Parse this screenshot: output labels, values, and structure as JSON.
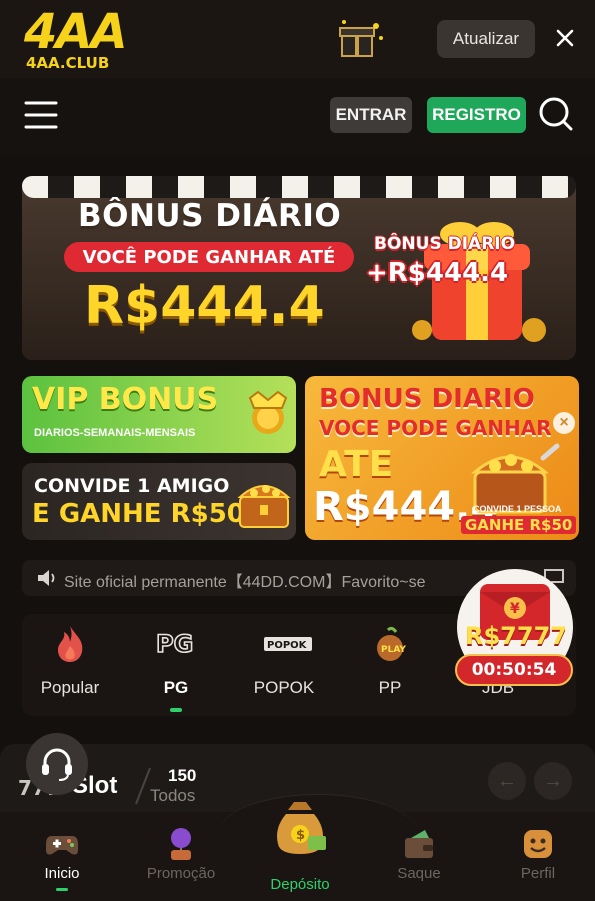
{
  "header": {
    "logo_main": "4AA",
    "logo_sub": "4AA.CLUB",
    "update_label": "Atualizar"
  },
  "nav": {
    "login_label": "ENTRAR",
    "register_label": "REGISTRO"
  },
  "hero": {
    "title": "BÔNUS DIÁRIO",
    "pill": "VOCÊ PODE GANHAR ATÉ",
    "amount": "R$444.4",
    "badge_line1": "BÔNUS DIÁRIO",
    "badge_line2": "+R$444.4"
  },
  "cards": {
    "vip_title": "VIP BONUS",
    "vip_sub": "DIARIOS-SEMANAIS-MENSAIS",
    "convide_line1": "CONVIDE 1 AMIGO",
    "convide_line2": "E GANHE R$50",
    "bonus_line1": "BONUS DIARIO",
    "bonus_line2": "VOCE PODE GANHAR",
    "bonus_line3": "ATE",
    "bonus_line4": "R$444.4",
    "bonus_tag1": "CONVIDE 1 PESSOA",
    "bonus_tag2": "GANHE R$50"
  },
  "marquee": {
    "text": "Site oficial permanente【44DD.COM】Favorito~se"
  },
  "categories": [
    {
      "label": "Popular",
      "icon": "fire-icon"
    },
    {
      "label": "PG",
      "icon": "pg-logo-icon"
    },
    {
      "label": "POPOK",
      "icon": "popok-logo-icon"
    },
    {
      "label": "PP",
      "icon": "pp-play-icon"
    },
    {
      "label": "JDB",
      "icon": "jdb-logo-icon"
    }
  ],
  "promo_float": {
    "amount": "R$7777",
    "timer": "00:50:54"
  },
  "section": {
    "icon_text": "777",
    "title": "Slot",
    "count": "150",
    "all_label": "Todos"
  },
  "tabs": [
    {
      "label": "Inicio",
      "icon": "gamepad-icon"
    },
    {
      "label": "Promoção",
      "icon": "promo-balloon-icon"
    },
    {
      "label": "Depósito",
      "icon": "money-bag-icon"
    },
    {
      "label": "Saque",
      "icon": "wallet-icon"
    },
    {
      "label": "Perfil",
      "icon": "smiley-profile-icon"
    }
  ],
  "colors": {
    "accent_green": "#20a85a",
    "gold": "#ffd529",
    "red": "#e02a33",
    "bg": "#14100d"
  }
}
